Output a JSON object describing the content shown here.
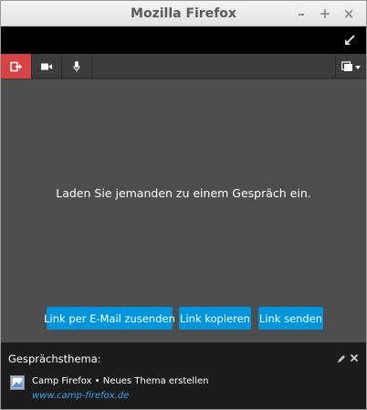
{
  "window": {
    "title": "Mozilla Firefox",
    "minimize": "–",
    "maximize": "+",
    "close": "×"
  },
  "toolbar": {
    "hangup_icon": "hangup-icon",
    "video_icon": "camera-icon",
    "audio_icon": "microphone-icon",
    "screen_icon": "screen-share-icon",
    "expand_icon": "expand-icon",
    "hangup_color": "#d74345"
  },
  "main": {
    "invite_text": "Laden Sie jemanden zu einem Gespräch ein.",
    "buttons": {
      "email": "Link per E-Mail zusenden",
      "copy": "Link kopieren",
      "send": "Link senden"
    },
    "button_color": "#0095dd"
  },
  "topic": {
    "label": "Gesprächsthema:",
    "room_title": "Camp Firefox • Neues Thema erstellen",
    "room_url": "www.camp-firefox.de",
    "url_color": "#31a3ee"
  }
}
